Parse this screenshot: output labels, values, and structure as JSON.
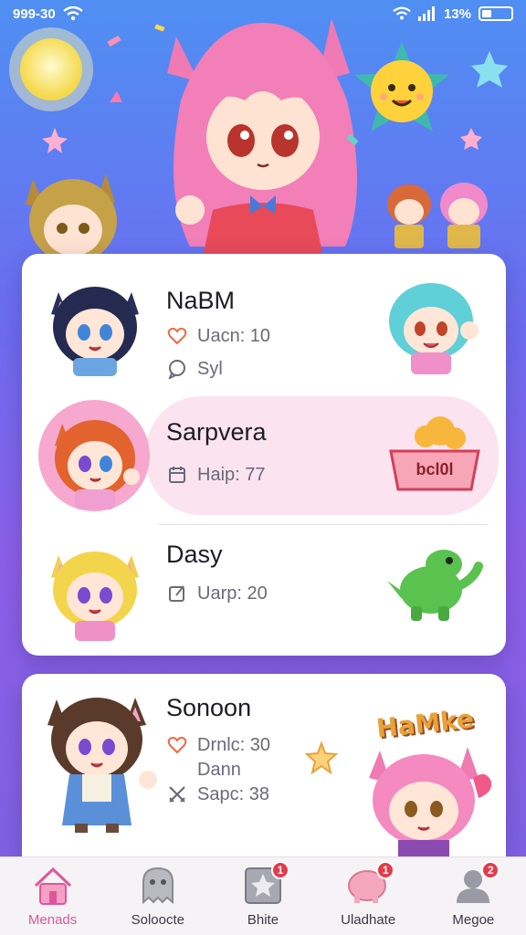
{
  "status_bar": {
    "time": "999-30",
    "battery_text": "13%",
    "icons": [
      "wifi-icon",
      "signal-icon",
      "battery-icon"
    ]
  },
  "colors": {
    "accent": "#e0569a",
    "active_row": "#fbe3f0",
    "badge": "#e43b4b"
  },
  "list": [
    {
      "name": "NaBM",
      "meta": [
        {
          "icon": "heart-icon",
          "text": "Uacn: 10"
        },
        {
          "icon": "chat-icon",
          "text": "Syl"
        }
      ]
    },
    {
      "name": "Sarpvera",
      "meta": [
        {
          "icon": "calendar-icon",
          "text": "Haip: 77"
        }
      ],
      "side_label": "bcl0l"
    },
    {
      "name": "Dasy",
      "meta": [
        {
          "icon": "edit-icon",
          "text": "Uarp: 20"
        }
      ]
    }
  ],
  "second_card": {
    "name": "Sonoon",
    "meta": [
      {
        "icon": "heart-icon",
        "text": "Drnlc: 30"
      },
      {
        "icon": "",
        "text": "Dann"
      },
      {
        "icon": "swords-icon",
        "text": "Sapc: 38"
      }
    ],
    "sticker_text": "HaMke"
  },
  "bottom_nav": [
    {
      "label": "Menads",
      "icon": "home-icon",
      "active": true,
      "badge": ""
    },
    {
      "label": "Soloocte",
      "icon": "ghost-icon",
      "active": false,
      "badge": ""
    },
    {
      "label": "Bhite",
      "icon": "star-box-icon",
      "active": false,
      "badge": "1"
    },
    {
      "label": "Uladhate",
      "icon": "pig-icon",
      "active": false,
      "badge": "1"
    },
    {
      "label": "Megoe",
      "icon": "profile-icon",
      "active": false,
      "badge": "2"
    }
  ]
}
